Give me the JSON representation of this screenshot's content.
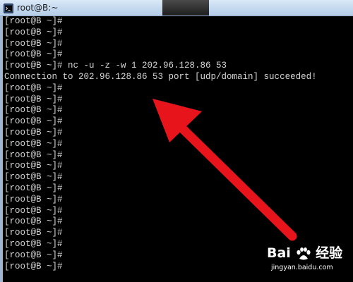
{
  "window": {
    "title": "root@B:~",
    "icon": "terminal-app-icon"
  },
  "terminal": {
    "lines_before": [
      "[root@B ~]#",
      "[root@B ~]#",
      "[root@B ~]#",
      "[root@B ~]#"
    ],
    "command": "[root@B ~]# nc -u -z -w 1 202.96.128.86 53",
    "output": "Connection to 202.96.128.86 53 port [udp/domain] succeeded!",
    "lines_after": [
      "[root@B ~]#",
      "[root@B ~]#",
      "[root@B ~]#",
      "[root@B ~]#",
      "[root@B ~]#",
      "[root@B ~]#",
      "[root@B ~]#",
      "[root@B ~]#",
      "[root@B ~]#",
      "[root@B ~]#",
      "[root@B ~]#",
      "[root@B ~]#",
      "[root@B ~]#",
      "[root@B ~]#",
      "[root@B ~]#",
      "[root@B ~]#",
      "[root@B ~]#"
    ]
  },
  "annotation": {
    "arrow_color": "#e8141b"
  },
  "watermark": {
    "brand_left": "Bai",
    "brand_right": "经验",
    "url": "jingyan.baidu.com"
  }
}
